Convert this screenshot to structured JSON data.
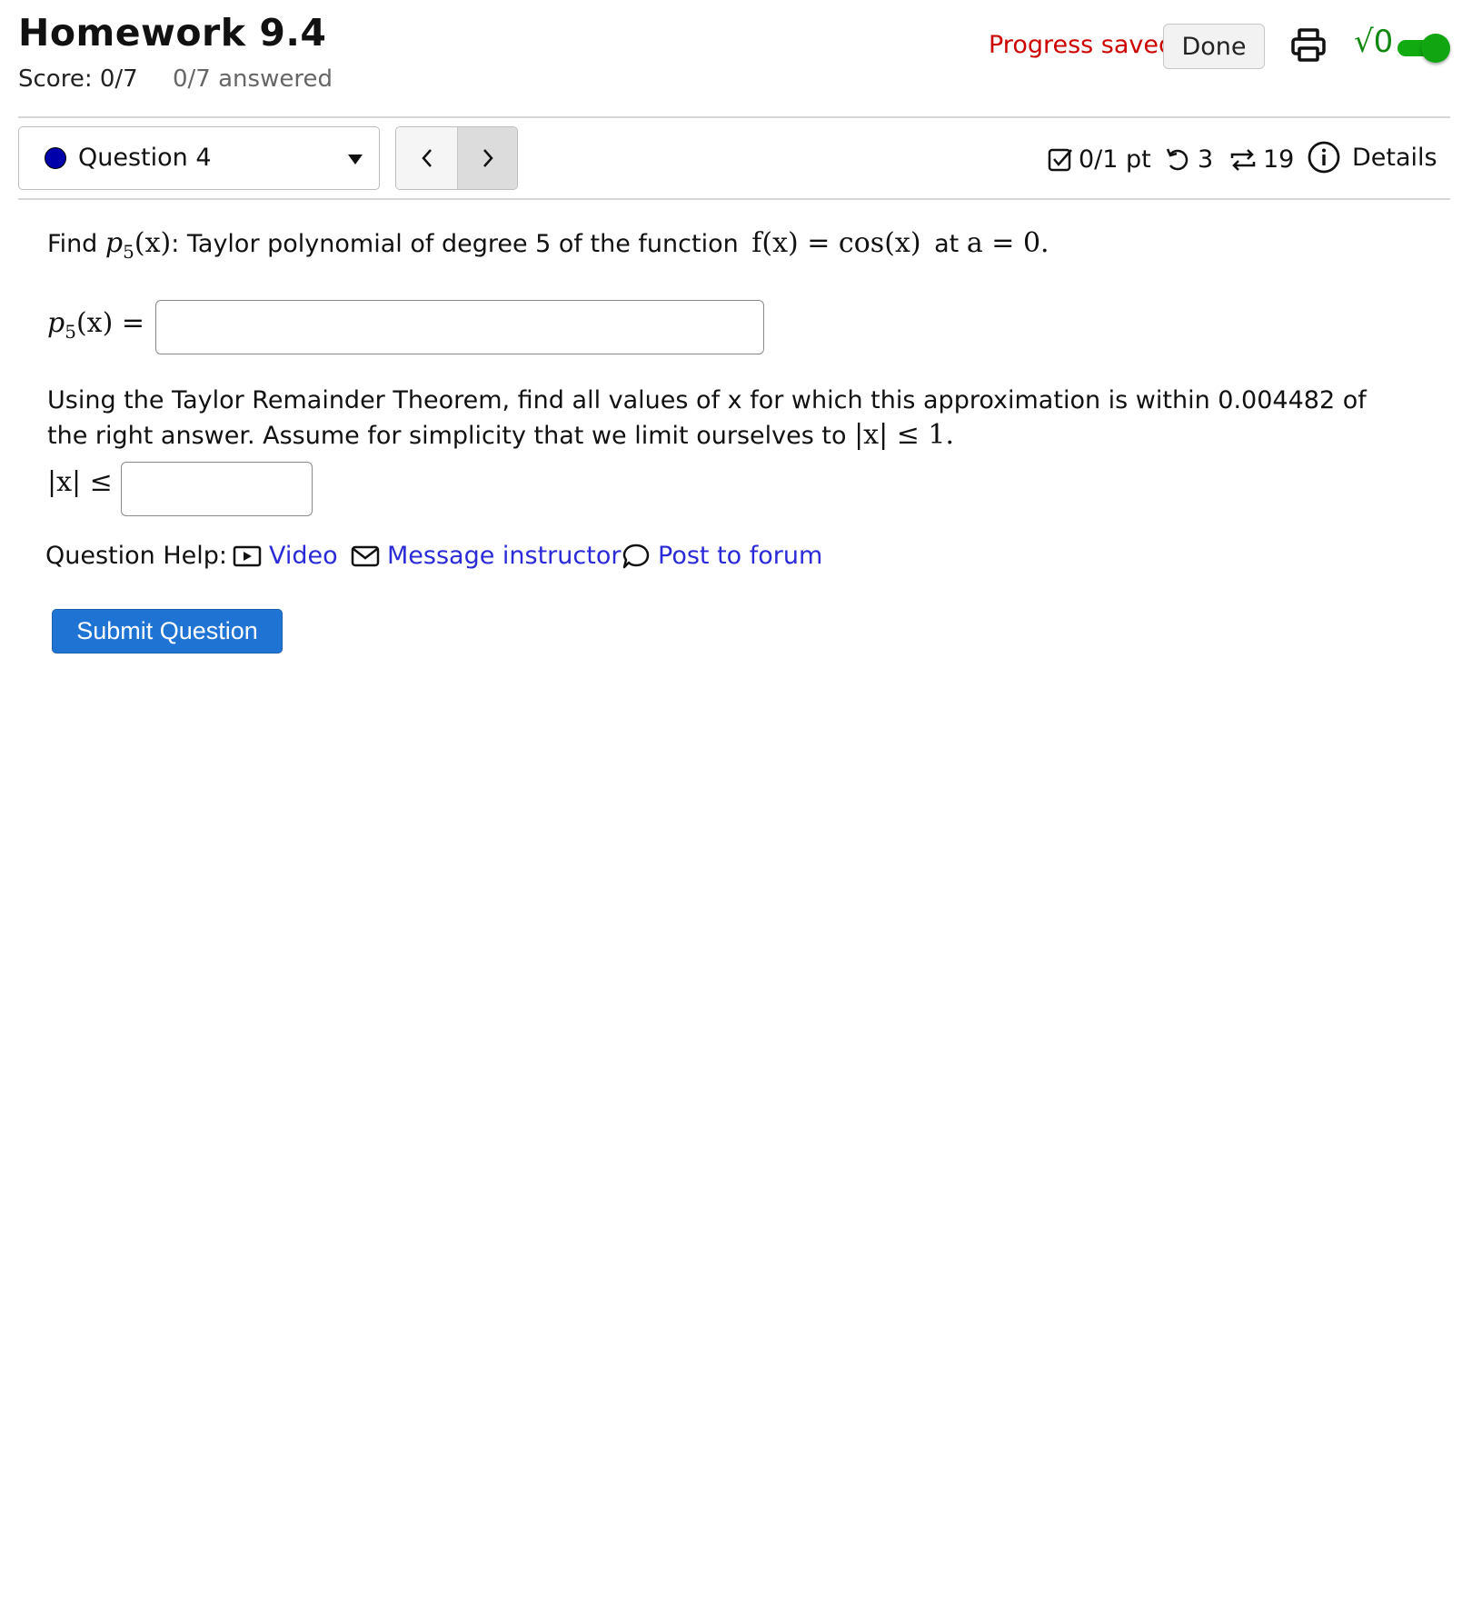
{
  "header": {
    "title": "Homework 9.4",
    "score": "Score: 0/7",
    "answered": "0/7 answered",
    "progress": "Progress saved",
    "done_label": "Done",
    "math_toggle_symbol": "√0"
  },
  "question_bar": {
    "selected_question": "Question 4",
    "prev_glyph": "<",
    "next_glyph": ">",
    "points": "0/1 pt",
    "retries": "3",
    "attempts": "19",
    "details_label": "Details"
  },
  "problem": {
    "find_label": "Find",
    "p5_p": "p",
    "p5_sub": "5",
    "p5_arg": "(x)",
    "find_text": ": Taylor polynomial of degree 5 of the function",
    "f_expr": "f(x) = cos(x)",
    "at_label": "at",
    "a_expr": "a = 0.",
    "answer1_eq": "(x) =",
    "remainder_line1": "Using the Taylor Remainder Theorem, find all values of x for which this approximation is within 0.004482 of",
    "remainder_line2": "the right answer. Assume for simplicity that we limit ourselves to",
    "abs_limit_expr": "|x| ≤ 1.",
    "answer2_label": "|x| ≤"
  },
  "help": {
    "label": "Question Help:",
    "video": "Video",
    "message": "Message instructor",
    "forum": "Post to forum"
  },
  "submit_label": "Submit Question",
  "colors": {
    "accent_blue": "#1f74d3",
    "link_blue": "#2a2ad8",
    "progress_red": "#cc0000",
    "toggle_green": "#11aa11"
  }
}
